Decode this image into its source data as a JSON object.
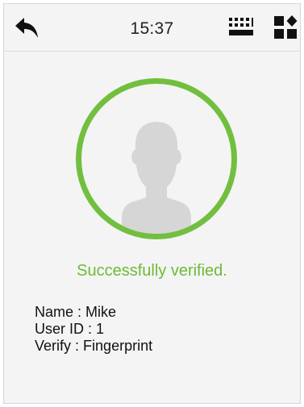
{
  "header": {
    "time": "15:37",
    "back_icon": "back-arrow-icon",
    "keyboard_icon": "keyboard-icon",
    "apps_icon": "apps-grid-icon"
  },
  "verification": {
    "status_text": "Successfully verified.",
    "status_color": "#6dbb36",
    "ring_color": "#72bf3f",
    "avatar_icon": "user-silhouette-icon"
  },
  "user_info": {
    "name_label": "Name",
    "name_value": "Mike",
    "user_id_label": "User ID",
    "user_id_value": "1",
    "verify_label": "Verify",
    "verify_value": "Fingerprint",
    "separator": " : "
  }
}
